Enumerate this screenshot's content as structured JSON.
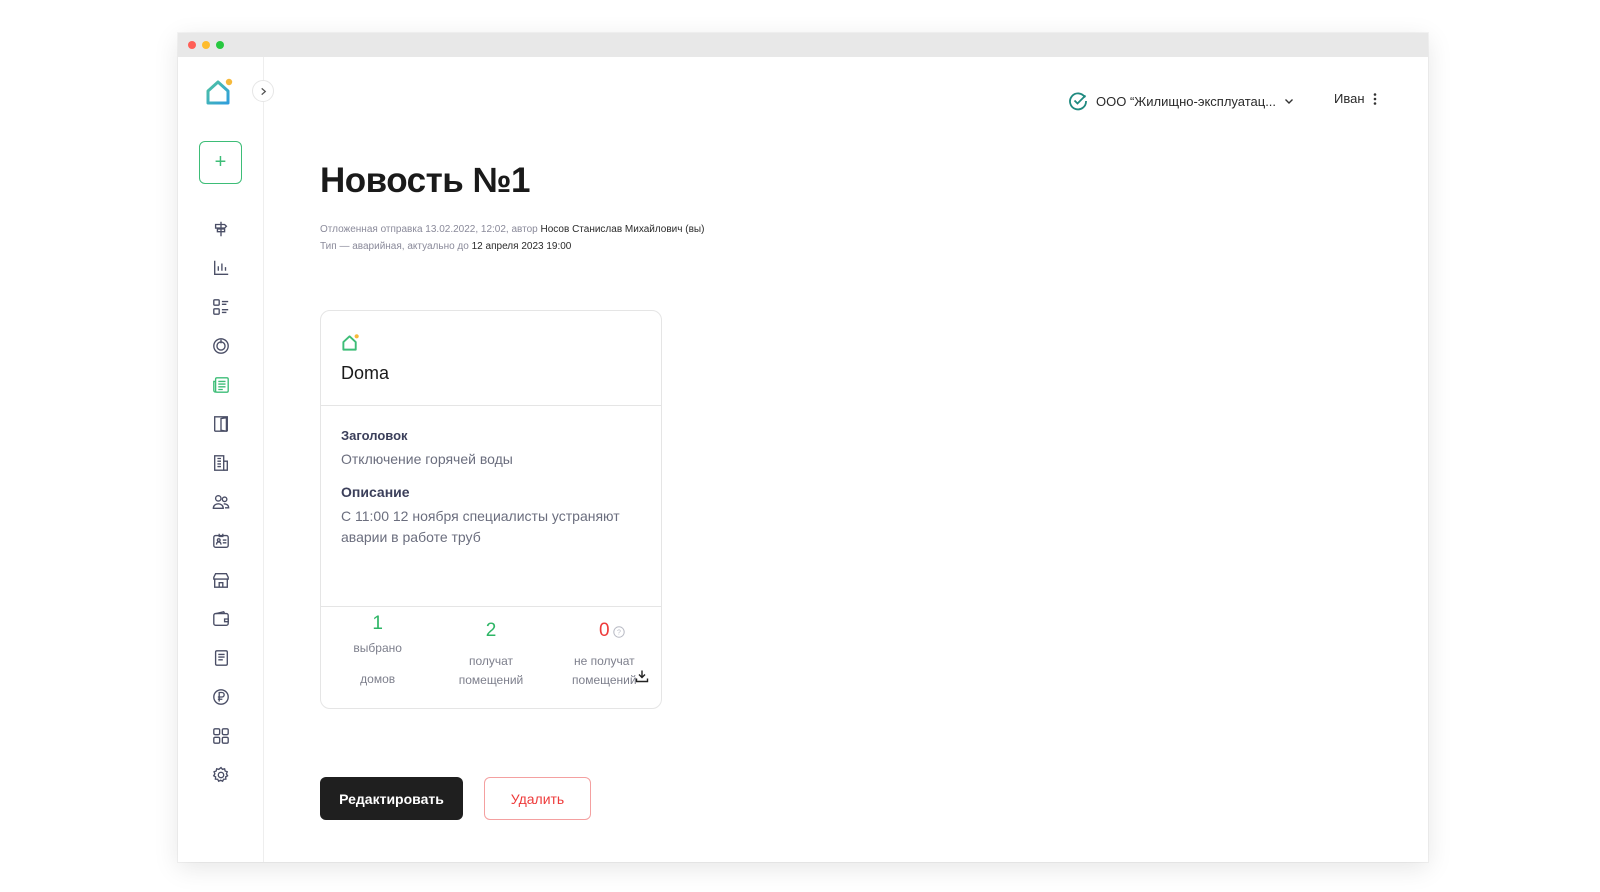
{
  "header": {
    "org_name": "ООО “Жилищно-эксплуатац...",
    "user_name": "Иван"
  },
  "sidebar": {
    "add_label": "+",
    "items": [
      {
        "icon": "signpost-icon"
      },
      {
        "icon": "bar-chart-icon"
      },
      {
        "icon": "list-grid-icon"
      },
      {
        "icon": "power-icon"
      },
      {
        "icon": "newspaper-icon",
        "active": true
      },
      {
        "icon": "door-icon"
      },
      {
        "icon": "building-icon"
      },
      {
        "icon": "users-icon"
      },
      {
        "icon": "id-badge-icon"
      },
      {
        "icon": "store-icon"
      },
      {
        "icon": "wallet-icon"
      },
      {
        "icon": "document-icon"
      },
      {
        "icon": "ruble-icon"
      },
      {
        "icon": "apps-grid-icon"
      },
      {
        "icon": "gear-icon"
      }
    ]
  },
  "page": {
    "title": "Новость №1",
    "meta_line1_prefix": "Отложенная отправка 13.02.2022, 12:02, автор",
    "meta_line1_author": "Носов Станислав Михайлович (вы)",
    "meta_line2_prefix": "Тип — аварийная, актуально до",
    "meta_line2_date": "12 апреля 2023 19:00"
  },
  "card": {
    "brand": "Doma",
    "title_label": "Заголовок",
    "title_value": "Отключение горячей воды",
    "desc_label": "Описание",
    "desc_value": "С 11:00 12 ноября специалисты устраняют аварии в работе труб",
    "stats": [
      {
        "value": "1",
        "label_line1": "выбрано",
        "label_line2": "домов"
      },
      {
        "value": "2",
        "label_line1": "получат",
        "label_line2": "помещений"
      },
      {
        "value": "0",
        "label_line1": "не получат",
        "label_line2": "помещений"
      }
    ]
  },
  "actions": {
    "edit_label": "Редактировать",
    "delete_label": "Удалить"
  },
  "colors": {
    "accent": "#3dbd77",
    "danger": "#ee3b3b",
    "logo_dot": "#f6b93b"
  }
}
